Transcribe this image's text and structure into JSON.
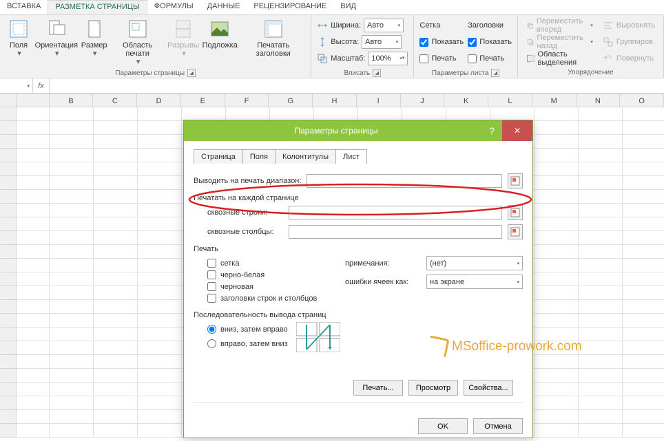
{
  "ribbon_tabs": [
    "ВСТАВКА",
    "РАЗМЕТКА СТРАНИЦЫ",
    "ФОРМУЛЫ",
    "ДАННЫЕ",
    "РЕЦЕНЗИРОВАНИЕ",
    "ВИД"
  ],
  "active_tab": 1,
  "groups": {
    "page_setup": {
      "label": "Параметры страницы",
      "margins": "Поля",
      "orientation": "Ориентация",
      "size": "Размер",
      "print_area": "Область печати",
      "breaks": "Разрывы",
      "background": "Подложка",
      "print_titles": "Печатать заголовки"
    },
    "fit": {
      "label": "Вписать",
      "width": "Ширина:",
      "height": "Высота:",
      "scale": "Масштаб:",
      "width_val": "Авто",
      "height_val": "Авто",
      "scale_val": "100%"
    },
    "sheet": {
      "label": "Параметры листа",
      "gridlines": "Сетка",
      "headings": "Заголовки",
      "show": "Показать",
      "print": "Печать"
    },
    "arrange": {
      "label": "Упорядочение",
      "bring_forward": "Переместить вперед",
      "send_backward": "Переместить назад",
      "selection_pane": "Область выделения",
      "align": "Выровнять",
      "group": "Группиров",
      "rotate": "Повернуть"
    }
  },
  "formula_bar": {
    "fx": "fx"
  },
  "columns": [
    "B",
    "C",
    "D",
    "E",
    "F",
    "G",
    "H",
    "I",
    "J",
    "K",
    "L",
    "M",
    "N",
    "O"
  ],
  "dialog": {
    "title": "Параметры страницы",
    "tabs": [
      "Страница",
      "Поля",
      "Колонтитулы",
      "Лист"
    ],
    "active_tab": 3,
    "print_range_label": "Выводить на печать диапазон:",
    "print_each_page": "Печатать на каждой странице",
    "rows_repeat": "сквозные строки:",
    "cols_repeat": "сквозные столбцы:",
    "print_group": "Печать",
    "chk_grid": "сетка",
    "chk_bw": "черно-белая",
    "chk_draft": "черновая",
    "chk_headings": "заголовки строк и столбцов",
    "comments_label": "примечания:",
    "comments_val": "(нет)",
    "errors_label": "ошибки ячеек как:",
    "errors_val": "на экране",
    "order_group": "Последовательность вывода страниц",
    "order_down": "вниз, затем вправо",
    "order_over": "вправо, затем вниз",
    "btn_print": "Печать...",
    "btn_preview": "Просмотр",
    "btn_props": "Свойства...",
    "btn_ok": "OK",
    "btn_cancel": "Отмена"
  },
  "watermark": "MSoffice-prowork.com"
}
